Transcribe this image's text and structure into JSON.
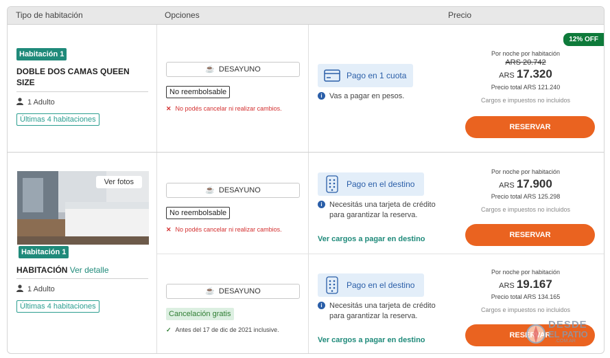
{
  "columns": {
    "type": "Tipo de habitación",
    "options": "Opciones",
    "price": "Precio"
  },
  "rooms": [
    {
      "badge": "Habitación 1",
      "name_line1": "DOBLE DOS CAMAS QUEEN",
      "name_line2": "SIZE",
      "adults": "1 Adulto",
      "availability": "Últimas 4 habitaciones",
      "options": [
        {
          "meal": "DESAYUNO",
          "policy": "No reembolsable",
          "policy_note": "No podés cancelar ni realizar cambios.",
          "payment": "Pago en 1 cuota",
          "payment_info": "Vas a pagar en pesos.",
          "discount": "12% OFF",
          "per_night": "Por noche por habitación",
          "old_price": "ARS 20.742",
          "currency": "ARS",
          "price": "17.320",
          "total": "Precio total ARS 121.240",
          "taxes": "Cargos e impuestos no incluidos",
          "button": "RESERVAR"
        }
      ]
    },
    {
      "badge": "Habitación 1",
      "photos_button": "Ver fotos",
      "name": "HABITACIÓN",
      "detail_link": "Ver detalle",
      "adults": "1 Adulto",
      "availability": "Últimas 4 habitaciones",
      "options": [
        {
          "meal": "DESAYUNO",
          "policy": "No reembolsable",
          "policy_note": "No podés cancelar ni realizar cambios.",
          "payment": "Pago en el destino",
          "payment_info_1": "Necesitás una tarjeta de crédito",
          "payment_info_2": "para garantizar la reserva.",
          "charges_link": "Ver cargos a pagar en destino",
          "per_night": "Por noche por habitación",
          "currency": "ARS",
          "price": "17.900",
          "total": "Precio total ARS 125.298",
          "taxes": "Cargos e impuestos no incluidos",
          "button": "RESERVAR"
        },
        {
          "meal": "DESAYUNO",
          "policy": "Cancelación gratis",
          "policy_note": "Antes del 17 de dic  de 2021 inclusive.",
          "payment": "Pago en el destino",
          "payment_info_1": "Necesitás una tarjeta de crédito",
          "payment_info_2": "para garantizar la reserva.",
          "charges_link": "Ver cargos a pagar en destino",
          "per_night": "Por noche por habitación",
          "currency": "ARS",
          "price": "19.167",
          "total": "Precio total ARS 134.165",
          "taxes": "Cargos e impuestos no incluidos",
          "button": "RESERVAR"
        }
      ]
    }
  ],
  "watermark": {
    "line1": "DESDE",
    "line2": "EL PATIO",
    "line3": ".COM.AR"
  },
  "colors": {
    "accent_orange": "#ea6320",
    "teal": "#1f8a7a",
    "blue": "#2a5ea8",
    "discount_green": "#0e7a3a"
  }
}
